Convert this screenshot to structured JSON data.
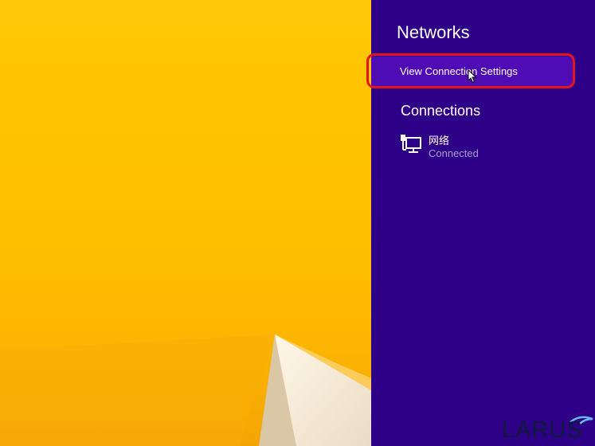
{
  "panel": {
    "title": "Networks",
    "connection_settings_label": "View Connection Settings",
    "connections_header": "Connections",
    "networks": [
      {
        "name": "网络",
        "status": "Connected"
      }
    ]
  },
  "watermark": {
    "text": "LARUS"
  },
  "colors": {
    "panel_background": "#2e0087",
    "settings_highlight": "#4f0bb4",
    "annotation_ring": "#e3141b",
    "status_text": "#a99cd2",
    "wallpaper": "#ffc400"
  }
}
